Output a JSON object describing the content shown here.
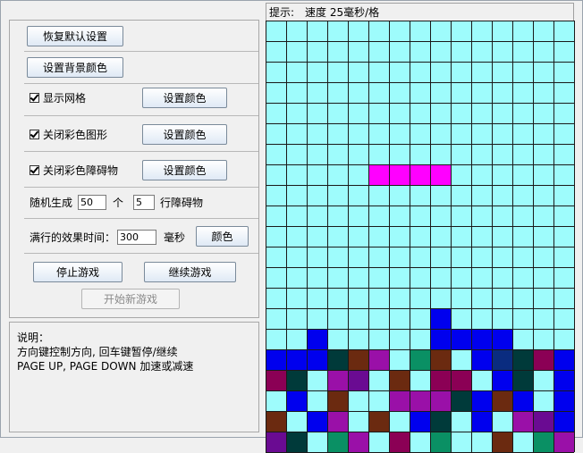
{
  "controls": {
    "reset_default_label": "恢复默认设置",
    "bg_color_label": "设置背景颜色",
    "show_grid_label": "显示网格",
    "show_grid_checked": true,
    "close_color_shape_label": "关闭彩色图形",
    "close_color_shape_checked": true,
    "close_color_obstacle_label": "关闭彩色障碍物",
    "close_color_obstacle_checked": true,
    "set_color_label": "设置颜色",
    "random_label": "随机生成",
    "random_count": "50",
    "unit_ge": "个",
    "random_rows": "5",
    "rows_obstacle_label": "行障碍物",
    "effect_time_label": "满行的效果时间：",
    "effect_time_value": "300",
    "unit_ms": "毫秒",
    "effect_color_label": "颜色",
    "stop_game_label": "停止游戏",
    "continue_game_label": "继续游戏",
    "new_game_label": "开始新游戏"
  },
  "info": {
    "title": "说明：",
    "line1": "方向键控制方向, 回车键暂停/继续",
    "line2": "PAGE UP, PAGE DOWN 加速或减速"
  },
  "hint": {
    "label": "提示:",
    "speed_text": "速度 25毫秒/格"
  },
  "board": {
    "cols": 15,
    "rows": 20,
    "background_color": "#9efcfc",
    "grid_color": "#1a1a1a",
    "palette": {
      "b": "#0000ee",
      "d": "#003a3a",
      "m": "#8b0055",
      "p": "#6a0b92",
      "n": "#0a2c80",
      "g": "#0a9064",
      "r": "#6b2a10",
      "v": "#9a10a8",
      "f": "#ff00ff"
    },
    "cells": [
      "...............",
      "...............",
      "...............",
      "...............",
      "...............",
      "...............",
      "...............",
      ".....ffff......",
      "...............",
      "...............",
      "...............",
      "...............",
      "...............",
      "...............",
      "........b......",
      "..b.....bbbb...",
      "bbbdrv.gr.bndmb",
      "md.vp.r.mm.bd.b",
      ".b.r..vvvdbrb.b",
      "r.bv.r.bd.b.vpb",
      "pd.gv.m.g..r.gv"
    ]
  }
}
